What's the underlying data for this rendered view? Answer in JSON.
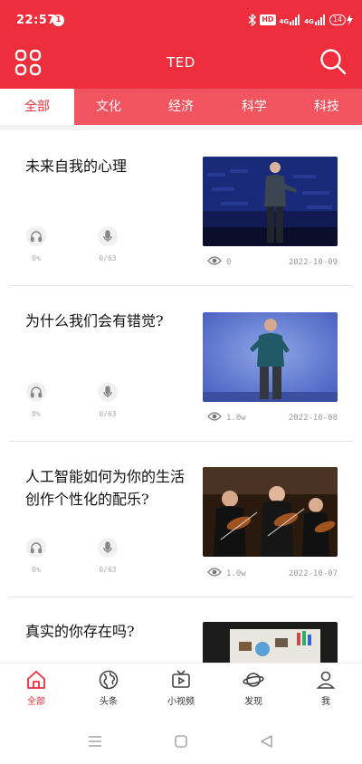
{
  "status": {
    "time": "22:57",
    "notification_count": "1",
    "hd": "HD",
    "net1": "4G",
    "net2": "4G",
    "battery": "14"
  },
  "header": {
    "title": "TED",
    "menu_icon": "grid-menu-icon",
    "search_icon": "search-icon"
  },
  "tabs": [
    {
      "label": "全部",
      "active": true
    },
    {
      "label": "文化",
      "active": false
    },
    {
      "label": "经济",
      "active": false
    },
    {
      "label": "科学",
      "active": false
    },
    {
      "label": "科技",
      "active": false
    }
  ],
  "feed": [
    {
      "title_lines": [
        "未来自我的心理"
      ],
      "listen_progress": "0%",
      "record_count": "0/63",
      "views": "0",
      "date": "2022-10-09"
    },
    {
      "title_lines": [
        "为什么我们会有错觉?"
      ],
      "listen_progress": "0%",
      "record_count": "0/63",
      "views": "1.0w",
      "date": "2022-10-08"
    },
    {
      "title_lines": [
        "人工智能如何为你的生活",
        "创作个性化的配乐?"
      ],
      "listen_progress": "0%",
      "record_count": "0/63",
      "views": "1.0w",
      "date": "2022-10-07"
    },
    {
      "title_lines": [
        "真实的你存在吗?"
      ],
      "listen_progress": "",
      "record_count": "",
      "views": "",
      "date": ""
    }
  ],
  "bottom_nav": [
    {
      "label": "全部",
      "icon": "home-icon",
      "active": true
    },
    {
      "label": "头条",
      "icon": "globe-icon",
      "active": false
    },
    {
      "label": "小视频",
      "icon": "tv-play-icon",
      "active": false
    },
    {
      "label": "发现",
      "icon": "planet-icon",
      "active": false
    },
    {
      "label": "我",
      "icon": "user-icon",
      "active": false
    }
  ],
  "colors": {
    "brand_red": "#ee2e3c",
    "tab_bar_red": "#f25560"
  }
}
